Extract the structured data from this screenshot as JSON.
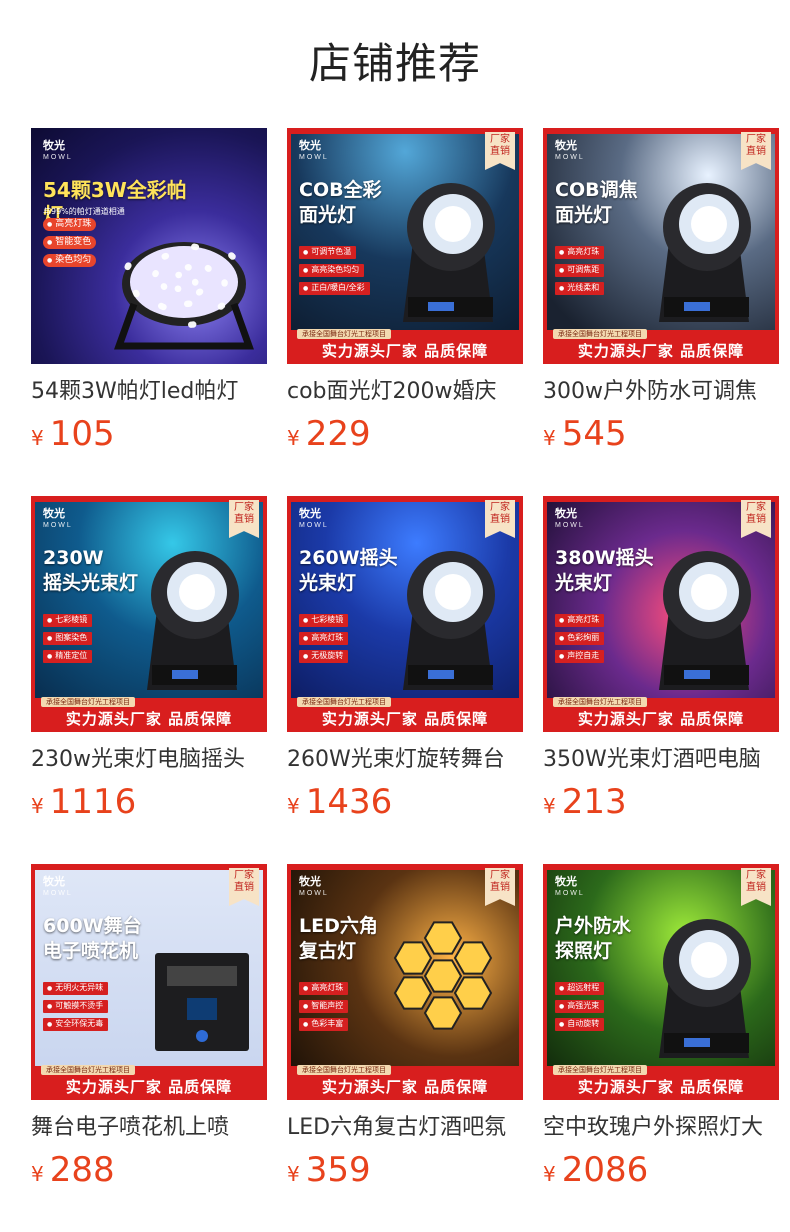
{
  "section_title": "店铺推荐",
  "common": {
    "brand": "牧光",
    "brand_en": "MOWL",
    "factory_badge": "厂家\n直销",
    "footer_small": "承接全国舞台灯光工程项目",
    "footer_main": "实力源头厂家 品质保障",
    "currency": "¥"
  },
  "products": [
    {
      "title": "54颗3W帕灯led帕灯",
      "price": "105",
      "headline": "54颗3W全彩帕灯",
      "subline": "与99%的帕灯通道相通",
      "features": [
        "高亮灯珠",
        "智能变色",
        "染色均匀"
      ],
      "has_badge": false,
      "has_footer": false
    },
    {
      "title": "cob面光灯200w婚庆",
      "price": "229",
      "headline": "COB全彩\n面光灯",
      "features": [
        "可调节色温",
        "高亮染色均匀",
        "正白/暖白/全彩"
      ],
      "has_badge": true,
      "has_footer": true
    },
    {
      "title": "300w户外防水可调焦",
      "price": "545",
      "headline": "COB调焦\n面光灯",
      "features": [
        "高亮灯珠",
        "可调焦距",
        "光线柔和"
      ],
      "has_badge": true,
      "has_footer": true
    },
    {
      "title": "230w光束灯电脑摇头",
      "price": "1116",
      "headline": "230W\n摇头光束灯",
      "features": [
        "七彩棱镜",
        "图案染色",
        "精准定位"
      ],
      "has_badge": true,
      "has_footer": true
    },
    {
      "title": "260W光束灯旋转舞台",
      "price": "1436",
      "headline": "260W摇头\n光束灯",
      "features": [
        "七彩棱镜",
        "高亮灯珠",
        "无极旋转"
      ],
      "has_badge": true,
      "has_footer": true
    },
    {
      "title": "350W光束灯酒吧电脑",
      "price": "213",
      "headline": "380W摇头\n光束灯",
      "features": [
        "高亮灯珠",
        "色彩绚丽",
        "声控自走"
      ],
      "has_badge": true,
      "has_footer": true
    },
    {
      "title": "舞台电子喷花机上喷",
      "price": "288",
      "headline": "600W舞台\n电子喷花机",
      "features": [
        "无明火无异味",
        "可触摸不烫手",
        "安全环保无毒"
      ],
      "has_badge": true,
      "has_footer": true
    },
    {
      "title": "LED六角复古灯酒吧氛",
      "price": "359",
      "headline": "LED六角\n复古灯",
      "features": [
        "高亮灯珠",
        "智能声控",
        "色彩丰富"
      ],
      "has_badge": true,
      "has_footer": true
    },
    {
      "title": "空中玫瑰户外探照灯大",
      "price": "2086",
      "headline": "户外防水\n探照灯",
      "features": [
        "超远射程",
        "高强光束",
        "自动旋转"
      ],
      "has_badge": true,
      "has_footer": true
    }
  ],
  "colors": {
    "price": "#e8421c",
    "accent_red": "#d81e1e"
  }
}
